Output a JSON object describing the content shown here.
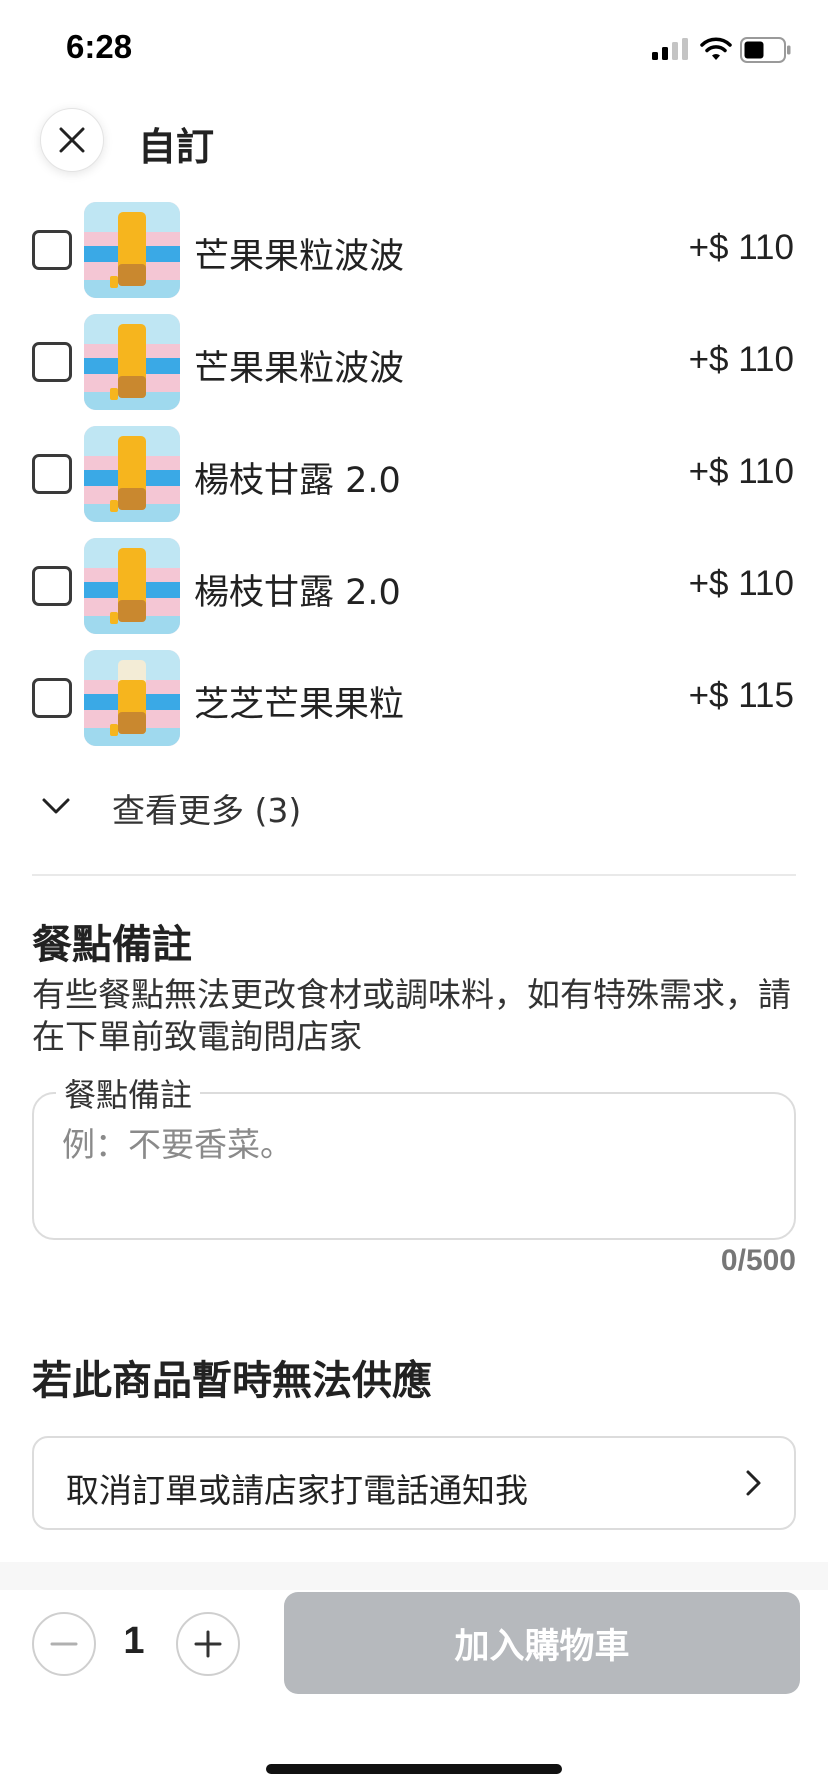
{
  "status_bar": {
    "time": "6:28"
  },
  "header": {
    "title": "自訂"
  },
  "options": [
    {
      "name": "芒果果粒波波",
      "price": "+$ 110",
      "thumb": "mango-bobo"
    },
    {
      "name": "芒果果粒波波",
      "price": "+$ 110",
      "thumb": "mango-bobo"
    },
    {
      "name": "楊枝甘露 2.0",
      "price": "+$ 110",
      "thumb": "pomelo-sago"
    },
    {
      "name": "楊枝甘露 2.0",
      "price": "+$ 110",
      "thumb": "pomelo-sago"
    },
    {
      "name": "芝芝芒果果粒",
      "price": "+$ 115",
      "thumb": "cheese-mango"
    }
  ],
  "see_more": {
    "label": "查看更多 (3)"
  },
  "notes": {
    "heading": "餐點備註",
    "description": "有些餐點無法更改食材或調味料，如有特殊需求，請在下單前致電詢問店家",
    "field_label": "餐點備註",
    "placeholder": "例：不要香菜。",
    "value": "",
    "char_count": "0/500"
  },
  "unavailable": {
    "heading": "若此商品暫時無法供應",
    "selected": "取消訂單或請店家打電話通知我"
  },
  "bottom": {
    "quantity": "1",
    "add_to_cart": "加入購物車"
  },
  "colors": {
    "button_disabled": "#b6b9bd",
    "thumb_bg_pink": "#f4c6d4",
    "thumb_band_blue": "#3aa9e6",
    "drink_yellow": "#f6b51e"
  }
}
